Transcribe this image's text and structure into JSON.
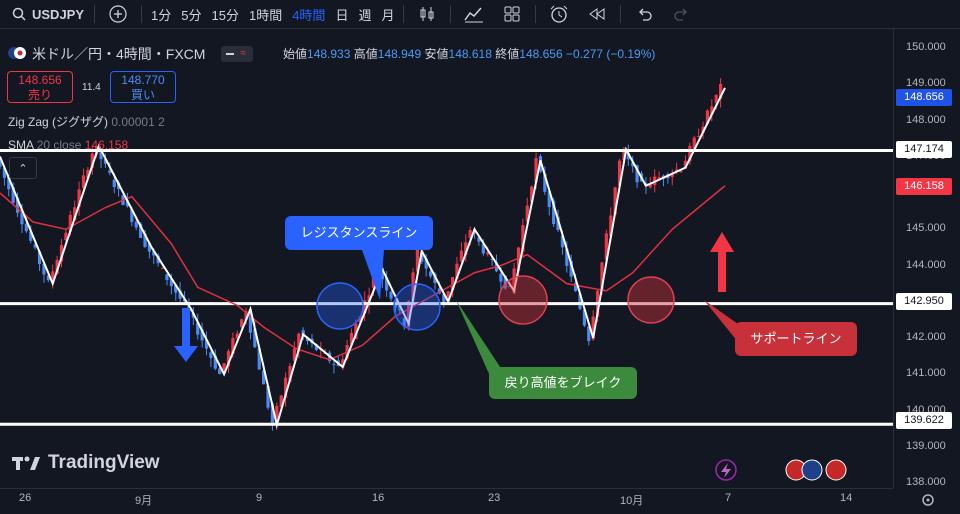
{
  "toolbar": {
    "symbol": "USDJPY",
    "timeframes": [
      "1分",
      "5分",
      "15分",
      "1時間",
      "4時間",
      "日",
      "週",
      "月"
    ],
    "active_timeframe": "4時間"
  },
  "legend": {
    "title": "米ドル／円・4時間・FXCM",
    "ohlc": {
      "open_label": "始値",
      "open": "148.933",
      "high_label": "高値",
      "high": "148.949",
      "low_label": "安値",
      "low": "148.618",
      "close_label": "終値",
      "close": "148.656",
      "change": "−0.277 (−0.19%)"
    },
    "sell": {
      "price": "148.656",
      "label": "売り"
    },
    "spread": "11.4",
    "buy": {
      "price": "148.770",
      "label": "買い"
    },
    "indicators": [
      {
        "name": "Zig Zag (ジグザグ)",
        "params": "0.00001 2"
      },
      {
        "name": "SMA",
        "params": "20 close",
        "value": "146.158"
      }
    ]
  },
  "price_axis": {
    "labels": [
      "150.000",
      "149.000",
      "148.000",
      "147.000",
      "146.000",
      "145.000",
      "144.000",
      "143.000",
      "142.000",
      "141.000",
      "140.000",
      "139.000",
      "138.000"
    ],
    "tags": {
      "last": "148.656",
      "resistance": "147.174",
      "sma": "146.158",
      "support": "142.950",
      "low": "139.622"
    }
  },
  "time_axis": {
    "labels": [
      "26",
      "9月",
      "9",
      "16",
      "23",
      "10月",
      "7",
      "14"
    ]
  },
  "annotations": {
    "resistance_callout": "レジスタンスライン",
    "breakout_callout": "戻り高値をブレイク",
    "support_callout": "サポートライン"
  },
  "watermark": "TradingView",
  "colors": {
    "background": "#131722",
    "up_candle": "#f23645",
    "down_candle": "#4c8bf5",
    "zigzag": "#ffffff",
    "sma": "#e03040",
    "resistance_callout": "#2962ff",
    "breakout_callout": "#3c8a3c",
    "support_callout": "#c8303a"
  },
  "chart_data": {
    "type": "line",
    "series": [
      {
        "name": "Zig Zag (ジグザグ)",
        "x": [
          0,
          8,
          15,
          23,
          29,
          34,
          38,
          42,
          46,
          52,
          58,
          62,
          64,
          68,
          72,
          78,
          82,
          90,
          95,
          98,
          104,
          110
        ],
        "y": [
          147.0,
          143.5,
          147.3,
          144.5,
          142.8,
          141.0,
          142.8,
          139.6,
          142.1,
          141.2,
          143.9,
          142.4,
          144.4,
          143.0,
          145.0,
          143.3,
          146.9,
          142.0,
          147.2,
          146.2,
          146.7,
          148.9
        ]
      },
      {
        "name": "SMA 20 close",
        "x": [
          0,
          5,
          10,
          16,
          20,
          26,
          30,
          36,
          40,
          45,
          50,
          55,
          60,
          66,
          72,
          76,
          80,
          86,
          92,
          96,
          102,
          110
        ],
        "y": [
          146.0,
          145.2,
          145.0,
          145.6,
          145.9,
          144.6,
          143.4,
          142.9,
          142.3,
          141.7,
          141.4,
          141.8,
          142.6,
          143.2,
          143.8,
          144.0,
          144.3,
          143.5,
          143.3,
          143.8,
          145.0,
          146.2
        ]
      }
    ],
    "horizontal_lines": [
      147.174,
      142.95,
      139.622
    ],
    "ylim": [
      137.8,
      150.3
    ]
  }
}
